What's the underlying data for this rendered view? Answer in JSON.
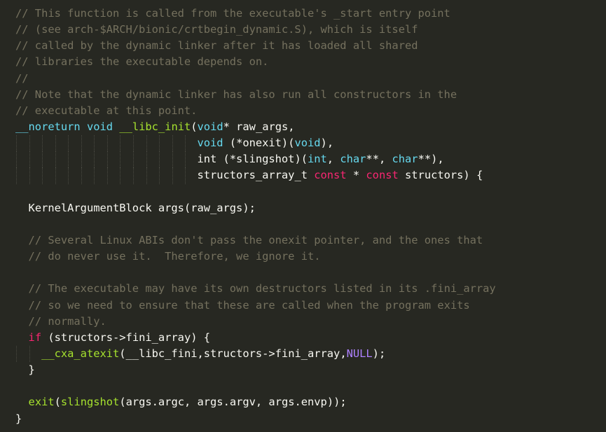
{
  "colors": {
    "background": "#272822",
    "comment": "#75715e",
    "keyword": "#f92672",
    "type": "#66d9ef",
    "function": "#a6e22e",
    "constant": "#ae81ff",
    "text": "#f8f8f2"
  },
  "code": {
    "lines": [
      {
        "indent": 0,
        "guides": 0,
        "tokens": [
          {
            "c": "comment",
            "t": "// This function is called from the executable's _start entry point"
          }
        ]
      },
      {
        "indent": 0,
        "guides": 0,
        "tokens": [
          {
            "c": "comment",
            "t": "// (see arch-$ARCH/bionic/crtbegin_dynamic.S), which is itself"
          }
        ]
      },
      {
        "indent": 0,
        "guides": 0,
        "tokens": [
          {
            "c": "comment",
            "t": "// called by the dynamic linker after it has loaded all shared"
          }
        ]
      },
      {
        "indent": 0,
        "guides": 0,
        "tokens": [
          {
            "c": "comment",
            "t": "// libraries the executable depends on."
          }
        ]
      },
      {
        "indent": 0,
        "guides": 0,
        "tokens": [
          {
            "c": "comment",
            "t": "//"
          }
        ]
      },
      {
        "indent": 0,
        "guides": 0,
        "tokens": [
          {
            "c": "comment",
            "t": "// Note that the dynamic linker has also run all constructors in the"
          }
        ]
      },
      {
        "indent": 0,
        "guides": 0,
        "tokens": [
          {
            "c": "comment",
            "t": "// executable at this point."
          }
        ]
      },
      {
        "indent": 0,
        "guides": 0,
        "tokens": [
          {
            "c": "ty",
            "t": "__noreturn"
          },
          {
            "c": "plain",
            "t": " "
          },
          {
            "c": "ty",
            "t": "void"
          },
          {
            "c": "plain",
            "t": " "
          },
          {
            "c": "fn",
            "t": "__libc_init"
          },
          {
            "c": "plain",
            "t": "("
          },
          {
            "c": "ty",
            "t": "void"
          },
          {
            "c": "plain",
            "t": "* raw_args,"
          }
        ]
      },
      {
        "indent": 28,
        "guides": 14,
        "tokens": [
          {
            "c": "ty",
            "t": "void"
          },
          {
            "c": "plain",
            "t": " (*onexit)("
          },
          {
            "c": "ty",
            "t": "void"
          },
          {
            "c": "plain",
            "t": "),"
          }
        ]
      },
      {
        "indent": 28,
        "guides": 14,
        "tokens": [
          {
            "c": "plain",
            "t": "int (*slingshot)("
          },
          {
            "c": "ty",
            "t": "int"
          },
          {
            "c": "plain",
            "t": ", "
          },
          {
            "c": "ty",
            "t": "char"
          },
          {
            "c": "plain",
            "t": "**, "
          },
          {
            "c": "ty",
            "t": "char"
          },
          {
            "c": "plain",
            "t": "**),"
          }
        ]
      },
      {
        "indent": 28,
        "guides": 14,
        "tokens": [
          {
            "c": "plain",
            "t": "structors_array_t "
          },
          {
            "c": "kw",
            "t": "const"
          },
          {
            "c": "plain",
            "t": " * "
          },
          {
            "c": "kw",
            "t": "const"
          },
          {
            "c": "plain",
            "t": " structors) {"
          }
        ]
      },
      {
        "indent": 0,
        "guides": 0,
        "tokens": []
      },
      {
        "indent": 2,
        "guides": 0,
        "tokens": [
          {
            "c": "plain",
            "t": "KernelArgumentBlock args(raw_args);"
          }
        ]
      },
      {
        "indent": 0,
        "guides": 0,
        "tokens": []
      },
      {
        "indent": 2,
        "guides": 0,
        "tokens": [
          {
            "c": "comment",
            "t": "// Several Linux ABIs don't pass the onexit pointer, and the ones that"
          }
        ]
      },
      {
        "indent": 2,
        "guides": 0,
        "tokens": [
          {
            "c": "comment",
            "t": "// do never use it.  Therefore, we ignore it."
          }
        ]
      },
      {
        "indent": 0,
        "guides": 0,
        "tokens": []
      },
      {
        "indent": 2,
        "guides": 0,
        "tokens": [
          {
            "c": "comment",
            "t": "// The executable may have its own destructors listed in its .fini_array"
          }
        ]
      },
      {
        "indent": 2,
        "guides": 0,
        "tokens": [
          {
            "c": "comment",
            "t": "// so we need to ensure that these are called when the program exits"
          }
        ]
      },
      {
        "indent": 2,
        "guides": 0,
        "tokens": [
          {
            "c": "comment",
            "t": "// normally."
          }
        ]
      },
      {
        "indent": 2,
        "guides": 0,
        "tokens": [
          {
            "c": "kw",
            "t": "if"
          },
          {
            "c": "plain",
            "t": " (structors->fini_array) {"
          }
        ]
      },
      {
        "indent": 4,
        "guides": 2,
        "tokens": [
          {
            "c": "fn",
            "t": "__cxa_atexit"
          },
          {
            "c": "plain",
            "t": "(__libc_fini,structors->fini_array,"
          },
          {
            "c": "const",
            "t": "NULL"
          },
          {
            "c": "plain",
            "t": ");"
          }
        ]
      },
      {
        "indent": 2,
        "guides": 0,
        "tokens": [
          {
            "c": "plain",
            "t": "}"
          }
        ]
      },
      {
        "indent": 0,
        "guides": 0,
        "tokens": []
      },
      {
        "indent": 2,
        "guides": 0,
        "tokens": [
          {
            "c": "fn",
            "t": "exit"
          },
          {
            "c": "plain",
            "t": "("
          },
          {
            "c": "fn",
            "t": "slingshot"
          },
          {
            "c": "plain",
            "t": "(args.argc, args.argv, args.envp));"
          }
        ]
      },
      {
        "indent": 0,
        "guides": 0,
        "tokens": [
          {
            "c": "plain",
            "t": "}"
          }
        ]
      }
    ]
  }
}
